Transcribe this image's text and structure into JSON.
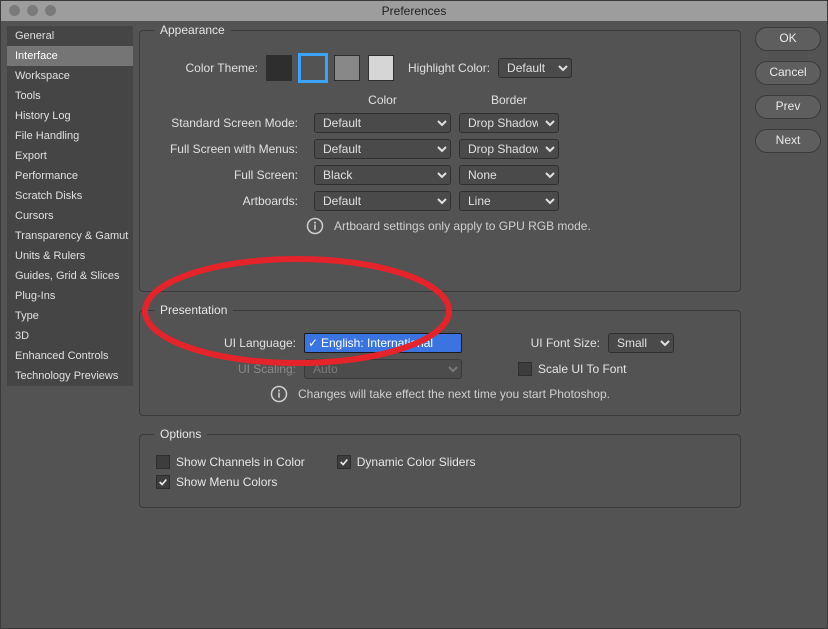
{
  "window_title": "Preferences",
  "sidebar": {
    "items": [
      "General",
      "Interface",
      "Workspace",
      "Tools",
      "History Log",
      "File Handling",
      "Export",
      "Performance",
      "Scratch Disks",
      "Cursors",
      "Transparency & Gamut",
      "Units & Rulers",
      "Guides, Grid & Slices",
      "Plug-Ins",
      "Type",
      "3D",
      "Enhanced Controls",
      "Technology Previews"
    ],
    "selected_index": 1
  },
  "buttons": {
    "ok": "OK",
    "cancel": "Cancel",
    "prev": "Prev",
    "next": "Next"
  },
  "appearance": {
    "legend": "Appearance",
    "color_theme_label": "Color Theme:",
    "swatches": [
      "#2e2e2e",
      "#535353",
      "#888888",
      "#d6d6d6"
    ],
    "selected_swatch": 1,
    "highlight_label": "Highlight Color:",
    "highlight_value": "Default",
    "col_color": "Color",
    "col_border": "Border",
    "rows": [
      {
        "label": "Standard Screen Mode:",
        "color": "Default",
        "border": "Drop Shadow"
      },
      {
        "label": "Full Screen with Menus:",
        "color": "Default",
        "border": "Drop Shadow"
      },
      {
        "label": "Full Screen:",
        "color": "Black",
        "border": "None"
      },
      {
        "label": "Artboards:",
        "color": "Default",
        "border": "Line"
      }
    ],
    "artboard_note": "Artboard settings only apply to GPU RGB mode."
  },
  "presentation": {
    "legend": "Presentation",
    "lang_label": "UI Language:",
    "lang_value": "English: International",
    "font_label": "UI Font Size:",
    "font_value": "Small",
    "scaling_label": "UI Scaling:",
    "scaling_value": "Auto",
    "scale_to_font_label": "Scale UI To Font",
    "scale_to_font_checked": false,
    "restart_note": "Changes will take effect the next time you start Photoshop."
  },
  "options": {
    "legend": "Options",
    "show_channels": "Show Channels in Color",
    "show_channels_checked": false,
    "dynamic_sliders": "Dynamic Color Sliders",
    "dynamic_sliders_checked": true,
    "show_menu_colors": "Show Menu Colors",
    "show_menu_colors_checked": true
  },
  "annotation": {
    "color": "#e4242a"
  }
}
